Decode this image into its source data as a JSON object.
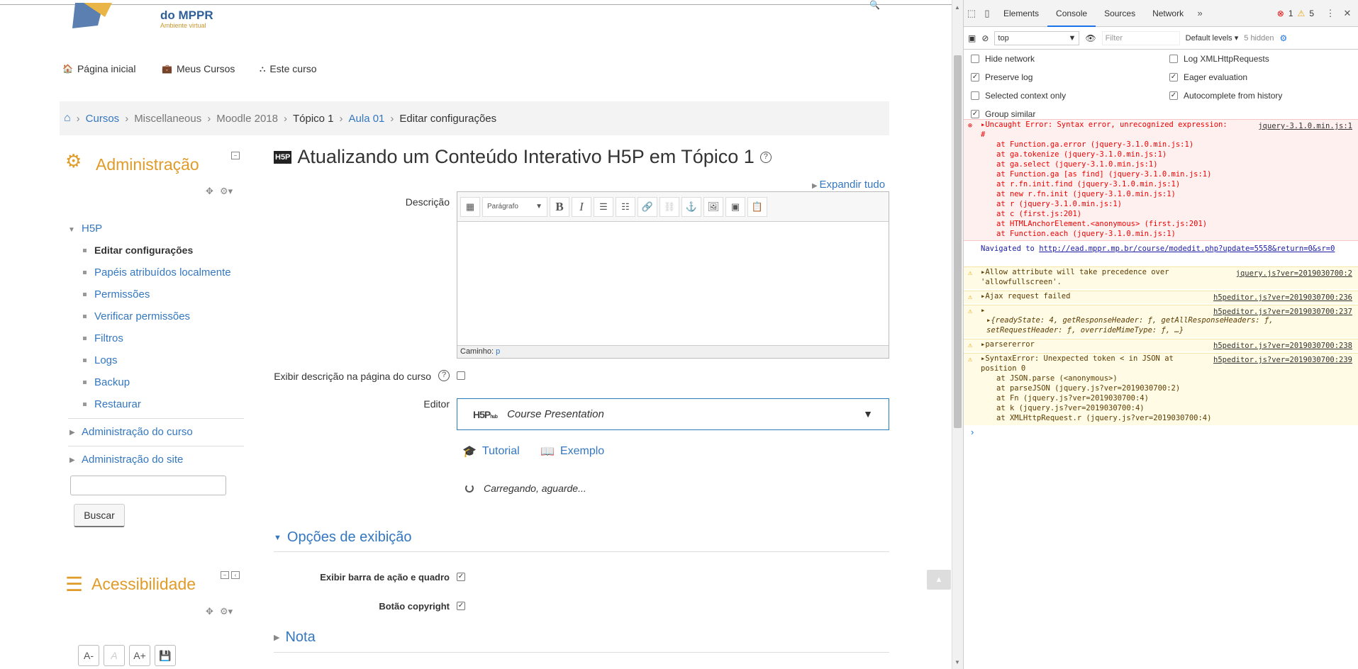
{
  "site": {
    "logo_text": "do MPPR",
    "logo_sub": "Ambiente virtual"
  },
  "nav": {
    "home": "Página inicial",
    "courses": "Meus Cursos",
    "this_course": "Este curso"
  },
  "breadcrumb": [
    "Cursos",
    "Miscellaneous",
    "Moodle 2018",
    "Tópico 1",
    "Aula 01",
    "Editar configurações"
  ],
  "admin_block": {
    "title": "Administração",
    "h5p": "H5P",
    "items": [
      "Editar configurações",
      "Papéis atribuídos localmente",
      "Permissões",
      "Verificar permissões",
      "Filtros",
      "Logs",
      "Backup",
      "Restaurar"
    ],
    "course_admin": "Administração do curso",
    "site_admin": "Administração do site",
    "search_button": "Buscar"
  },
  "accessibility": {
    "title": "Acessibilidade",
    "buttons": [
      "A-",
      "A",
      "A+"
    ]
  },
  "main": {
    "title": "Atualizando um Conteúdo Interativo H5P em Tópico 1",
    "h5p_badge": "H5P",
    "expand_all": "Expandir tudo",
    "description_label": "Descrição",
    "paragraph_select": "Parágrafo",
    "path_label": "Caminho:",
    "path_value": "p",
    "show_description_label": "Exibir descrição na página do curso",
    "editor_label": "Editor",
    "h5p_hub": "H5P",
    "h5p_hub_sub": "hub",
    "content_type": "Course Presentation",
    "tutorial": "Tutorial",
    "example": "Exemplo",
    "loading": "Carregando, aguarde...",
    "display_options": "Opções de exibição",
    "action_bar_label": "Exibir barra de ação e quadro",
    "copyright_label": "Botão copyright",
    "note": "Nota"
  },
  "devtools": {
    "tabs": [
      "Elements",
      "Console",
      "Sources",
      "Network"
    ],
    "active_tab": "Console",
    "errors_count": "1",
    "warnings_count": "5",
    "context": "top",
    "filter_placeholder": "Filter",
    "levels": "Default levels",
    "hidden": "5 hidden",
    "options": {
      "hide_network": "Hide network",
      "log_xhr": "Log XMLHttpRequests",
      "preserve_log": "Preserve log",
      "eager_eval": "Eager evaluation",
      "selected_context": "Selected context only",
      "autocomplete": "Autocomplete from history",
      "group_similar": "Group similar"
    },
    "error_msg": {
      "text": "Uncaught Error: Syntax error, unrecognized expression: #",
      "src": "jquery-3.1.0.min.js:1",
      "stack": [
        "at Function.ga.error (jquery-3.1.0.min.js:1)",
        "at ga.tokenize (jquery-3.1.0.min.js:1)",
        "at ga.select (jquery-3.1.0.min.js:1)",
        "at Function.ga [as find] (jquery-3.1.0.min.js:1)",
        "at r.fn.init.find (jquery-3.1.0.min.js:1)",
        "at new r.fn.init (jquery-3.1.0.min.js:1)",
        "at r (jquery-3.1.0.min.js:1)",
        "at c (first.js:201)",
        "at HTMLAnchorElement.<anonymous> (first.js:201)",
        "at Function.each (jquery-3.1.0.min.js:1)"
      ]
    },
    "navigated": {
      "prefix": "Navigated to",
      "url": "http://ead.mppr.mp.br/course/modedit.php?update=5558&return=0&sr=0"
    },
    "warn1": {
      "text": "Allow attribute will take precedence over 'allowfullscreen'.",
      "src": "jquery.js?ver=2019030700:2"
    },
    "warn2": {
      "text": "Ajax request failed",
      "src": "h5peditor.js?ver=2019030700:236"
    },
    "warn3": {
      "text": "{readyState: 4, getResponseHeader: ƒ, getAllResponseHeaders: ƒ, setRequestHeader: ƒ, overrideMimeType: ƒ, …}",
      "src": "h5peditor.js?ver=2019030700:237"
    },
    "warn4": {
      "text": "parsererror",
      "src": "h5peditor.js?ver=2019030700:238"
    },
    "warn5": {
      "text": "SyntaxError: Unexpected token < in JSON at position 0",
      "src": "h5peditor.js?ver=2019030700:239",
      "stack": [
        "at JSON.parse (<anonymous>)",
        "at parseJSON (jquery.js?ver=2019030700:2)",
        "at Fn (jquery.js?ver=2019030700:4)",
        "at k (jquery.js?ver=2019030700:4)",
        "at XMLHttpRequest.r (jquery.js?ver=2019030700:4)"
      ]
    }
  }
}
